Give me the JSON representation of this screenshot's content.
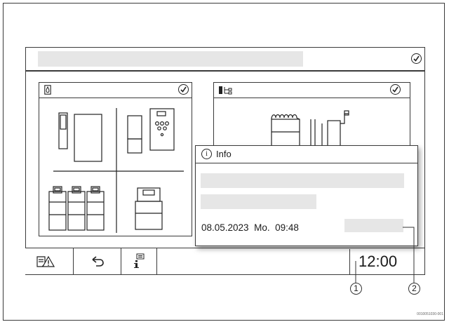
{
  "popup": {
    "title": "Info",
    "date": "08.05.2023",
    "weekday": "Mo.",
    "time": "09:48"
  },
  "status_bar": {
    "clock": "12:00"
  },
  "callouts": [
    "1",
    "2"
  ],
  "figure_ref": "0010051030-001",
  "icons": {
    "status_ok": "check-circle-icon",
    "heat_source": "flame-icon",
    "system": "system-diagram-icon",
    "warning": "document-warning-icon",
    "back": "back-arrow-icon",
    "info": "info-list-icon"
  },
  "colors": {
    "line": "#3a3a3a",
    "placeholder": "#e6e6e6"
  }
}
